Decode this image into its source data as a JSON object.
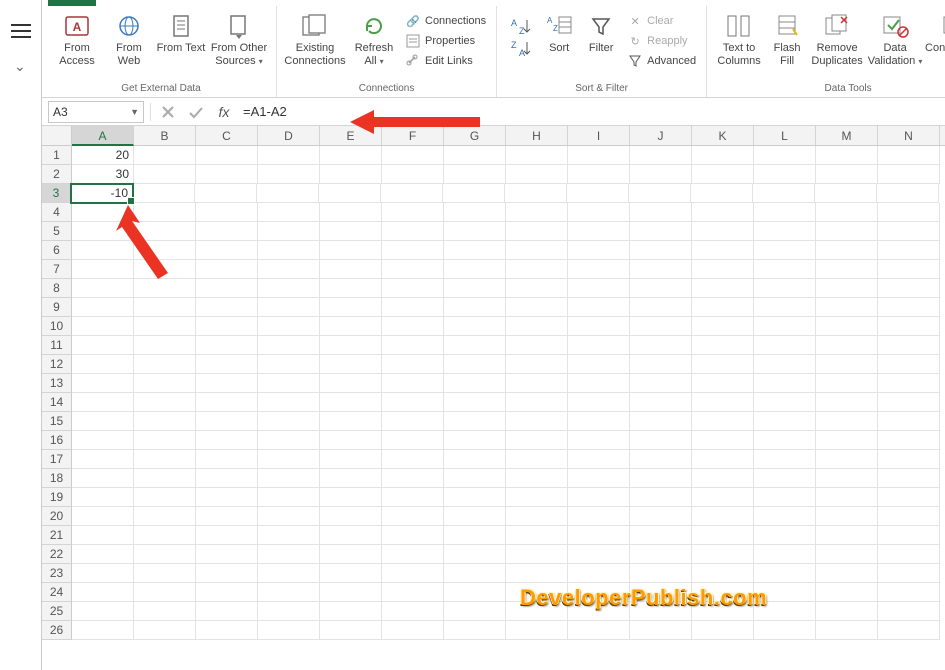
{
  "ribbon": {
    "groups": {
      "get_external_data": {
        "label": "Get External Data",
        "from_access": "From Access",
        "from_web": "From Web",
        "from_text": "From Text",
        "from_other_sources": "From Other Sources"
      },
      "connections": {
        "label": "Connections",
        "existing_connections": "Existing Connections",
        "refresh_all": "Refresh All",
        "connections_btn": "Connections",
        "properties": "Properties",
        "edit_links": "Edit Links"
      },
      "sort_filter": {
        "label": "Sort & Filter",
        "sort": "Sort",
        "filter": "Filter",
        "clear": "Clear",
        "reapply": "Reapply",
        "advanced": "Advanced"
      },
      "data_tools": {
        "label": "Data Tools",
        "text_to_columns": "Text to Columns",
        "flash_fill": "Flash Fill",
        "remove_duplicates": "Remove Duplicates",
        "data_validation": "Data Validation",
        "consolidate": "Consolidate"
      }
    }
  },
  "formula_bar": {
    "name_box": "A3",
    "fx_label": "fx",
    "formula": "=A1-A2"
  },
  "sheet": {
    "columns": [
      "A",
      "B",
      "C",
      "D",
      "E",
      "F",
      "G",
      "H",
      "I",
      "J",
      "K",
      "L",
      "M",
      "N"
    ],
    "rows_count": 26,
    "active_cell": {
      "row": 3,
      "col": "A"
    },
    "cells": {
      "A1": "20",
      "A2": "30",
      "A3": "-10"
    }
  },
  "watermark": "DeveloperPublish.com",
  "colors": {
    "accent": "#217346",
    "arrow": "#ea3323"
  }
}
